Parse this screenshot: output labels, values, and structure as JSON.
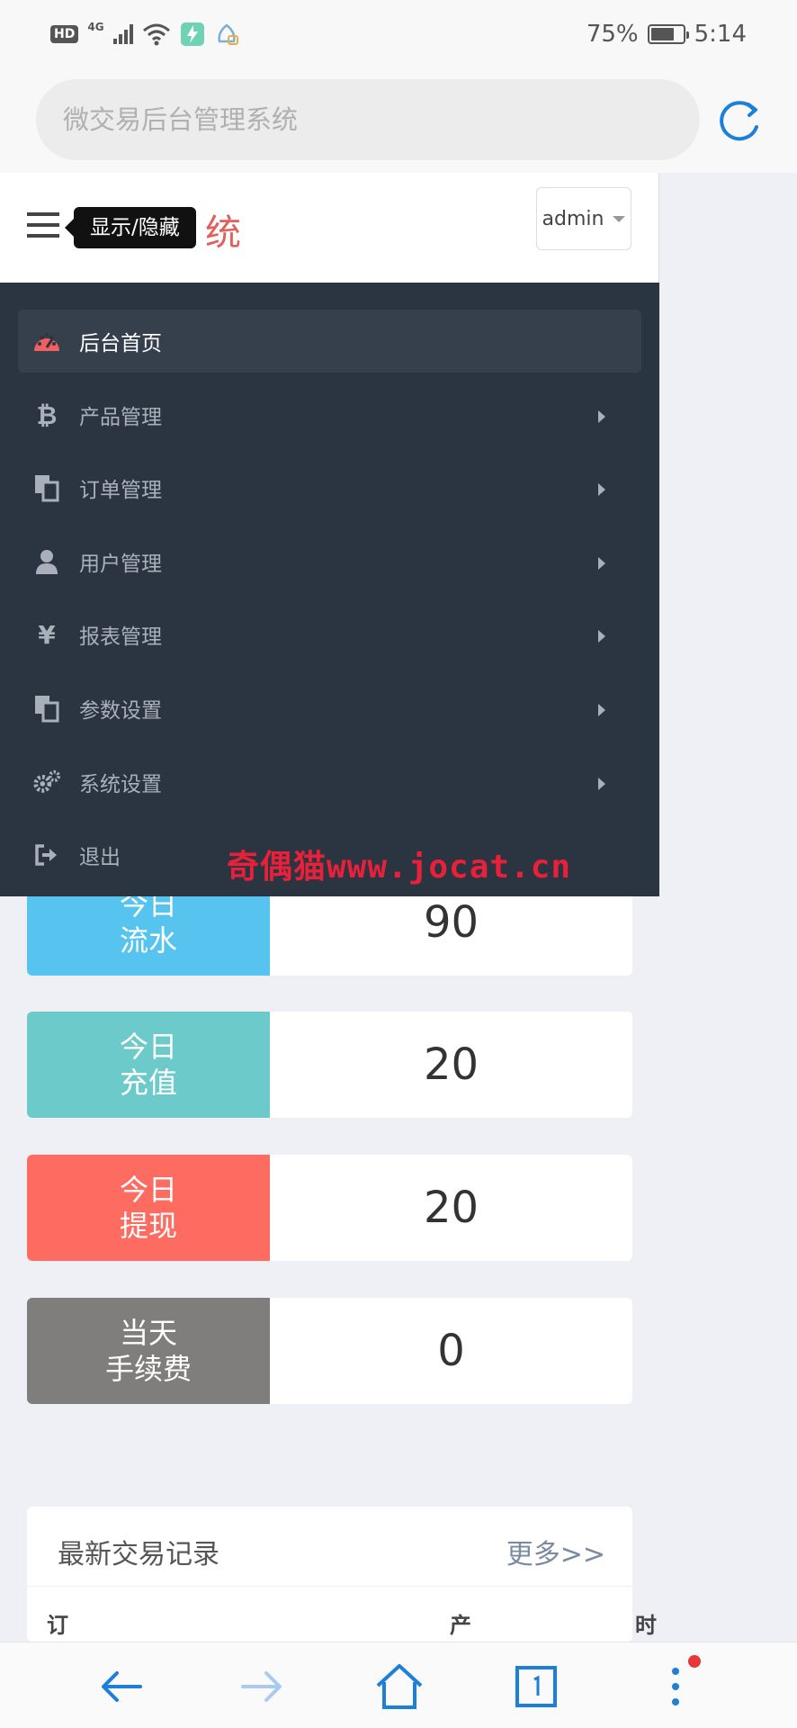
{
  "status_bar": {
    "network": "4G",
    "hd": "HD",
    "battery_percent": "75%",
    "battery_level": 0.75,
    "time": "5:14"
  },
  "browser": {
    "address_placeholder": "微交易后台管理系统"
  },
  "header": {
    "brand_visible_tail": "统",
    "tooltip": "显示/隐藏",
    "user_button": "admin"
  },
  "sidebar": {
    "items": [
      {
        "label": "后台首页",
        "icon": "dashboard-icon",
        "active": true,
        "has_submenu": false
      },
      {
        "label": "产品管理",
        "icon": "bitcoin-icon",
        "active": false,
        "has_submenu": true
      },
      {
        "label": "订单管理",
        "icon": "copy-icon",
        "active": false,
        "has_submenu": true
      },
      {
        "label": "用户管理",
        "icon": "user-icon",
        "active": false,
        "has_submenu": true
      },
      {
        "label": "报表管理",
        "icon": "yen-icon",
        "active": false,
        "has_submenu": true
      },
      {
        "label": "参数设置",
        "icon": "copy-icon",
        "active": false,
        "has_submenu": true
      },
      {
        "label": "系统设置",
        "icon": "gears-icon",
        "active": false,
        "has_submenu": true
      },
      {
        "label": "退出",
        "icon": "sign-out-icon",
        "active": false,
        "has_submenu": false
      }
    ]
  },
  "watermark": "奇偶猫www.jocat.cn",
  "stats": [
    {
      "label": "今日\n流水",
      "value": "90",
      "color": "#56c4ef"
    },
    {
      "label": "今日\n充值",
      "value": "20",
      "color": "#6ccbca"
    },
    {
      "label": "今日\n提现",
      "value": "20",
      "color": "#fe6c61"
    },
    {
      "label": "当天\n手续费",
      "value": "0",
      "color": "#7f7e7c"
    }
  ],
  "records": {
    "title": "最新交易记录",
    "more": "更多>>",
    "columns": [
      "订",
      "产",
      "时"
    ]
  },
  "colors": {
    "sidebar_bg": "#2b3441",
    "sidebar_active": "#36404d",
    "accent_blue": "#1e7fd8",
    "brand_red": "#e0605c"
  }
}
